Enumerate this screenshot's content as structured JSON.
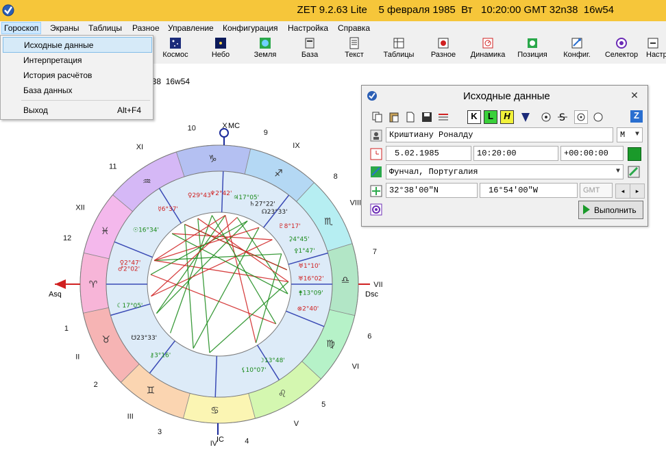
{
  "window": {
    "title": "ZET 9.2.63 Lite    5 февраля 1985  Вт   10:20:00 GMT 32n38  16w54",
    "accent": "#f6c63a"
  },
  "menubar": {
    "items": [
      "Гороскоп",
      "Экраны",
      "Таблицы",
      "Разное",
      "Управление",
      "Конфигурация",
      "Настройка",
      "Справка"
    ]
  },
  "toolbar": {
    "items": [
      "Космос",
      "Небо",
      "Земля",
      "База",
      "Текст",
      "Таблицы",
      "Разное",
      "Динамика",
      "Позиция",
      "Конфиг.",
      "Селектор",
      "Настр"
    ]
  },
  "dropdown": {
    "items": [
      {
        "label": "Исходные данные",
        "shortcut": ""
      },
      {
        "label": "Интерпретация",
        "shortcut": ""
      },
      {
        "label": "История расчётов",
        "shortcut": ""
      },
      {
        "label": "База данных",
        "shortcut": ""
      },
      {
        "label": "Выход",
        "shortcut": "Alt+F4"
      }
    ]
  },
  "background_text": "n38  16w54",
  "chart": {
    "angles": {
      "MC": "MC",
      "IC": "IC",
      "Asc": "Asc",
      "Dsc": "Dsc"
    },
    "house_numbers": [
      "1",
      "2",
      "3",
      "4",
      "5",
      "6",
      "7",
      "8",
      "9",
      "10",
      "11",
      "12"
    ],
    "roman_numbers": [
      "I",
      "II",
      "III",
      "IV",
      "V",
      "VI",
      "VII",
      "VIII",
      "IX",
      "X",
      "XI",
      "XII"
    ],
    "sign_glyphs": [
      "♈",
      "♉",
      "♊",
      "♋",
      "♌",
      "♍",
      "♎",
      "♏",
      "♐",
      "♑",
      "♒",
      "♓"
    ],
    "planet_labels": [
      {
        "glyph": "♀",
        "deg": "29°43'",
        "color": "#d02020"
      },
      {
        "glyph": "♆",
        "deg": "2°42'",
        "color": "#d02020"
      },
      {
        "glyph": "♃",
        "deg": "17°05'",
        "color": "#1a8a1a"
      },
      {
        "glyph": "☿",
        "deg": "6°37'",
        "color": "#d02020"
      },
      {
        "glyph": "♄",
        "deg": "27°22'",
        "color": "#1a1a1a"
      },
      {
        "glyph": "☊",
        "deg": "23°33'",
        "color": "#1a1a1a"
      },
      {
        "glyph": "♇",
        "deg": "8°17'",
        "color": "#d02020"
      },
      {
        "glyph": "☉",
        "deg": "16°34'",
        "color": "#1a8a1a"
      },
      {
        "glyph": "⚳",
        "deg": "4°45'",
        "color": "#1a8a1a"
      },
      {
        "glyph": "⚴",
        "deg": "1°47'",
        "color": "#1a8a1a"
      },
      {
        "glyph": "♅",
        "deg": "1°10'",
        "color": "#d02020"
      },
      {
        "glyph": "♅",
        "deg": "16°02'",
        "color": "#d02020"
      },
      {
        "glyph": "♂",
        "deg": "2°02'",
        "color": "#d02020"
      },
      {
        "glyph": "⚵",
        "deg": "13°09'",
        "color": "#1a8a1a"
      },
      {
        "glyph": "♀",
        "deg": "2°47'",
        "color": "#d02020"
      },
      {
        "glyph": "⊗",
        "deg": "2°40'",
        "color": "#d02020"
      },
      {
        "glyph": "☾",
        "deg": "17°05'",
        "color": "#1a8a1a"
      },
      {
        "glyph": "☋",
        "deg": "23°33'",
        "color": "#1a1a1a"
      },
      {
        "glyph": "☽",
        "deg": "13°48'",
        "color": "#1a8a1a"
      },
      {
        "glyph": "⚷",
        "deg": "3°16'",
        "color": "#1a8a1a"
      },
      {
        "glyph": "⚸",
        "deg": "10°07'",
        "color": "#1a8a1a"
      }
    ],
    "retro": "R"
  },
  "panel": {
    "title": "Исходные данные",
    "close": "✕",
    "name": "Криштиану Роналду",
    "gender": "М",
    "date": "5.02.1985",
    "time": "10:20:00",
    "offset": "+00:00:00",
    "place": "Фунчал, Португалия",
    "latitude": "32°38'00\"N",
    "longitude": "16°54'00\"W",
    "zone": "GMT",
    "exec_label": "Выполнить",
    "tool_letters": [
      "K",
      "L",
      "H",
      "Z"
    ]
  }
}
